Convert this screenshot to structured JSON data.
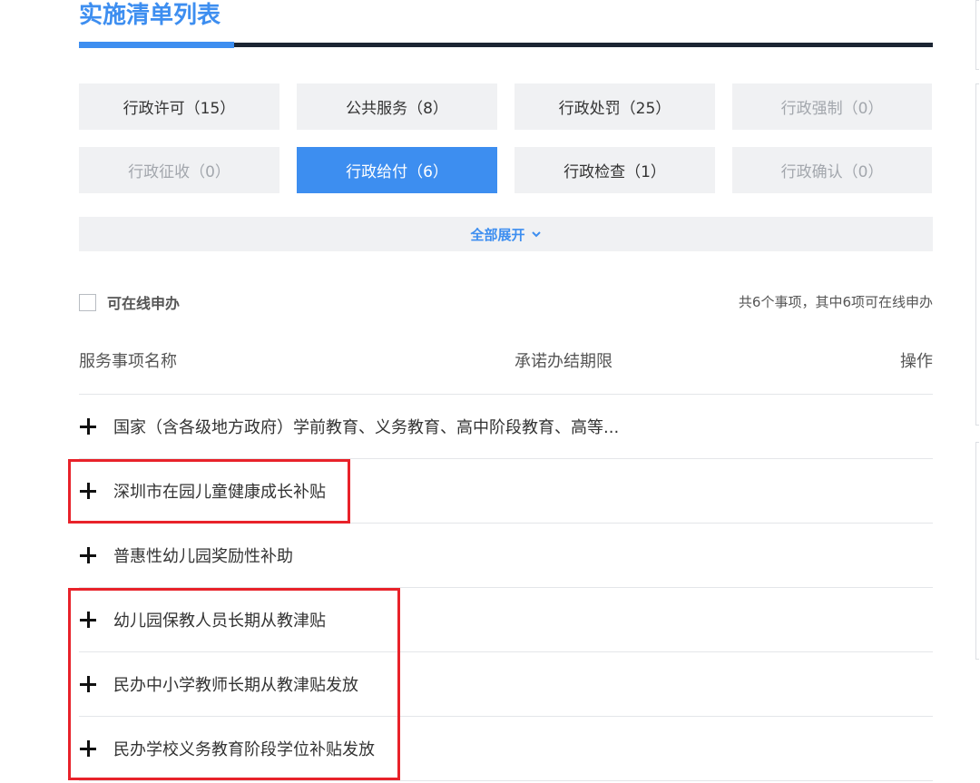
{
  "header": {
    "title": "实施清单列表"
  },
  "categories": [
    {
      "label": "行政许可（15）",
      "state": "normal"
    },
    {
      "label": "公共服务（8）",
      "state": "normal"
    },
    {
      "label": "行政处罚（25）",
      "state": "normal"
    },
    {
      "label": "行政强制（0）",
      "state": "disabled"
    },
    {
      "label": "行政征收（0）",
      "state": "disabled"
    },
    {
      "label": "行政给付（6）",
      "state": "active"
    },
    {
      "label": "行政检查（1）",
      "state": "normal"
    },
    {
      "label": "行政确认（0）",
      "state": "disabled"
    }
  ],
  "expand_all": {
    "label": "全部展开",
    "icon": "chevron-down-icon"
  },
  "filter": {
    "online_label": "可在线申办",
    "checked": false,
    "summary": "共6个事项，其中6项可在线申办"
  },
  "table": {
    "columns": {
      "name": "服务事项名称",
      "limit": "承诺办结期限",
      "operation": "操作"
    },
    "rows": [
      {
        "name": "国家（含各级地方政府）学前教育、义务教育、高中阶段教育、高等..."
      },
      {
        "name": "深圳市在园儿童健康成长补贴"
      },
      {
        "name": "普惠性幼儿园奖励性补助"
      },
      {
        "name": "幼儿园保教人员长期从教津贴"
      },
      {
        "name": "民办中小学教师长期从教津贴发放"
      },
      {
        "name": "民办学校义务教育阶段学位补贴发放"
      }
    ]
  },
  "colors": {
    "accent": "#3d8ef0",
    "dark_bar": "#1b2533",
    "tile_bg": "#f0f1f3",
    "highlight": "#e8222a"
  }
}
